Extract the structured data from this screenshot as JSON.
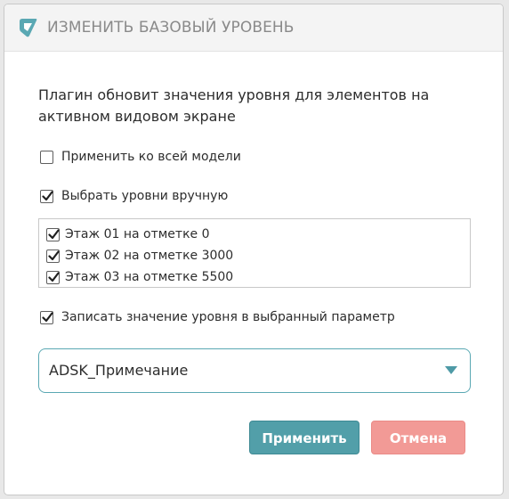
{
  "dialog": {
    "title": "ИЗМЕНИТЬ БАЗОВЫЙ УРОВЕНЬ",
    "logo_icon": "app-logo-icon",
    "description": "Плагин обновит значения уровня для элементов на активном видовом экране"
  },
  "options": {
    "apply_whole_model": {
      "label": "Применить ко всей модели",
      "checked": false
    },
    "select_levels_manually": {
      "label": "Выбрать уровни вручную",
      "checked": true
    },
    "write_to_parameter": {
      "label": "Записать значение уровня в выбранный параметр",
      "checked": true
    }
  },
  "levels": [
    {
      "label": "Этаж 01 на отметке 0",
      "checked": true
    },
    {
      "label": "Этаж 02 на отметке 3000",
      "checked": true
    },
    {
      "label": "Этаж 03 на отметке 5500",
      "checked": true
    }
  ],
  "parameter_select": {
    "value": "ADSK_Примечание"
  },
  "buttons": {
    "apply": "Применить",
    "cancel": "Отмена"
  },
  "colors": {
    "accent": "#529fa9",
    "cancel": "#f29a96",
    "select_border": "#5aa8b3",
    "title_text": "#8a8a8a"
  }
}
